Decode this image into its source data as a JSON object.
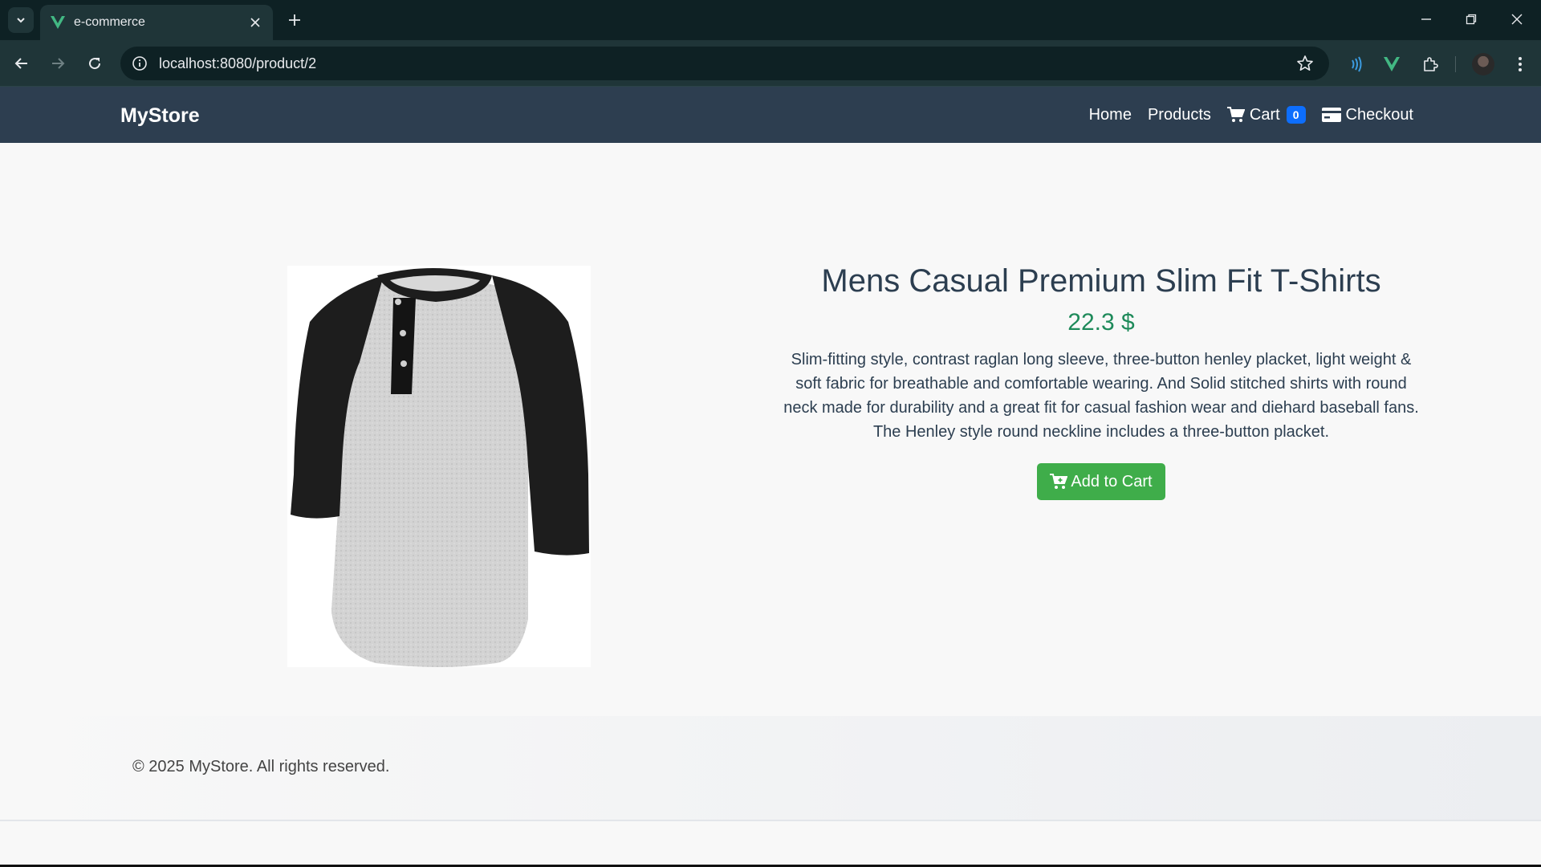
{
  "browser": {
    "tab_title": "e-commerce",
    "url": "localhost:8080/product/2"
  },
  "navbar": {
    "brand": "MyStore",
    "links": {
      "home": "Home",
      "products": "Products",
      "cart": "Cart",
      "cart_count": "0",
      "checkout": "Checkout"
    }
  },
  "product": {
    "title": "Mens Casual Premium Slim Fit T-Shirts",
    "price": "22.3 $",
    "description": "Slim-fitting style, contrast raglan long sleeve, three-button henley placket, light weight & soft fabric for breathable and comfortable wearing. And Solid stitched shirts with round neck made for durability and a great fit for casual fashion wear and diehard baseball fans. The Henley style round neckline includes a three-button placket.",
    "add_to_cart_label": "Add to Cart"
  },
  "footer": {
    "text": "© 2025 MyStore. All rights reserved."
  },
  "colors": {
    "navbar_bg": "#2d3e50",
    "price": "#1e8a5a",
    "add_button": "#3fad4a",
    "badge": "#0d6efd"
  }
}
